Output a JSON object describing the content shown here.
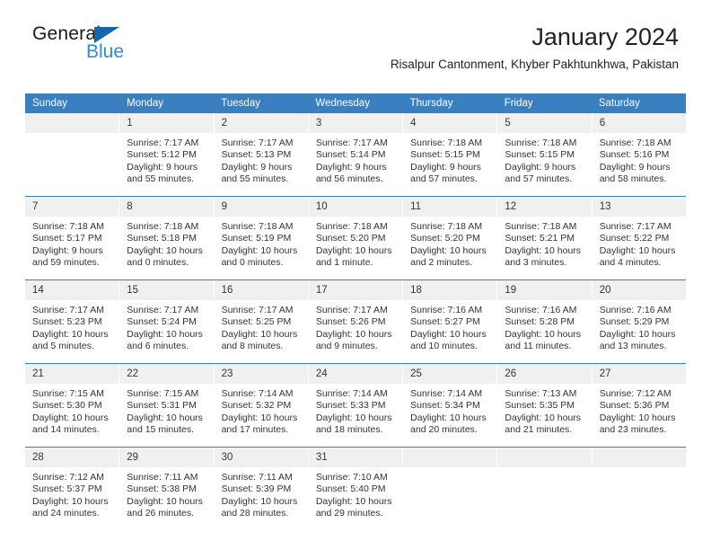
{
  "brand": {
    "name_part1": "General",
    "name_part2": "Blue"
  },
  "header": {
    "title": "January 2024",
    "subtitle": "Risalpur Cantonment, Khyber Pakhtunkhwa, Pakistan"
  },
  "colors": {
    "header_blue": "#3a7fc0",
    "logo_blue": "#1565b0",
    "logo_text_blue": "#2e8bd8",
    "day_number_bg": "#f0f0f0",
    "text": "#333333"
  },
  "weekdays": [
    "Sunday",
    "Monday",
    "Tuesday",
    "Wednesday",
    "Thursday",
    "Friday",
    "Saturday"
  ],
  "weeks": [
    [
      {
        "day": "",
        "sunrise": "",
        "sunset": "",
        "daylight": "",
        "empty": true
      },
      {
        "day": "1",
        "sunrise": "Sunrise: 7:17 AM",
        "sunset": "Sunset: 5:12 PM",
        "daylight": "Daylight: 9 hours and 55 minutes."
      },
      {
        "day": "2",
        "sunrise": "Sunrise: 7:17 AM",
        "sunset": "Sunset: 5:13 PM",
        "daylight": "Daylight: 9 hours and 55 minutes."
      },
      {
        "day": "3",
        "sunrise": "Sunrise: 7:17 AM",
        "sunset": "Sunset: 5:14 PM",
        "daylight": "Daylight: 9 hours and 56 minutes."
      },
      {
        "day": "4",
        "sunrise": "Sunrise: 7:18 AM",
        "sunset": "Sunset: 5:15 PM",
        "daylight": "Daylight: 9 hours and 57 minutes."
      },
      {
        "day": "5",
        "sunrise": "Sunrise: 7:18 AM",
        "sunset": "Sunset: 5:15 PM",
        "daylight": "Daylight: 9 hours and 57 minutes."
      },
      {
        "day": "6",
        "sunrise": "Sunrise: 7:18 AM",
        "sunset": "Sunset: 5:16 PM",
        "daylight": "Daylight: 9 hours and 58 minutes."
      }
    ],
    [
      {
        "day": "7",
        "sunrise": "Sunrise: 7:18 AM",
        "sunset": "Sunset: 5:17 PM",
        "daylight": "Daylight: 9 hours and 59 minutes."
      },
      {
        "day": "8",
        "sunrise": "Sunrise: 7:18 AM",
        "sunset": "Sunset: 5:18 PM",
        "daylight": "Daylight: 10 hours and 0 minutes."
      },
      {
        "day": "9",
        "sunrise": "Sunrise: 7:18 AM",
        "sunset": "Sunset: 5:19 PM",
        "daylight": "Daylight: 10 hours and 0 minutes."
      },
      {
        "day": "10",
        "sunrise": "Sunrise: 7:18 AM",
        "sunset": "Sunset: 5:20 PM",
        "daylight": "Daylight: 10 hours and 1 minute."
      },
      {
        "day": "11",
        "sunrise": "Sunrise: 7:18 AM",
        "sunset": "Sunset: 5:20 PM",
        "daylight": "Daylight: 10 hours and 2 minutes."
      },
      {
        "day": "12",
        "sunrise": "Sunrise: 7:18 AM",
        "sunset": "Sunset: 5:21 PM",
        "daylight": "Daylight: 10 hours and 3 minutes."
      },
      {
        "day": "13",
        "sunrise": "Sunrise: 7:17 AM",
        "sunset": "Sunset: 5:22 PM",
        "daylight": "Daylight: 10 hours and 4 minutes."
      }
    ],
    [
      {
        "day": "14",
        "sunrise": "Sunrise: 7:17 AM",
        "sunset": "Sunset: 5:23 PM",
        "daylight": "Daylight: 10 hours and 5 minutes."
      },
      {
        "day": "15",
        "sunrise": "Sunrise: 7:17 AM",
        "sunset": "Sunset: 5:24 PM",
        "daylight": "Daylight: 10 hours and 6 minutes."
      },
      {
        "day": "16",
        "sunrise": "Sunrise: 7:17 AM",
        "sunset": "Sunset: 5:25 PM",
        "daylight": "Daylight: 10 hours and 8 minutes."
      },
      {
        "day": "17",
        "sunrise": "Sunrise: 7:17 AM",
        "sunset": "Sunset: 5:26 PM",
        "daylight": "Daylight: 10 hours and 9 minutes."
      },
      {
        "day": "18",
        "sunrise": "Sunrise: 7:16 AM",
        "sunset": "Sunset: 5:27 PM",
        "daylight": "Daylight: 10 hours and 10 minutes."
      },
      {
        "day": "19",
        "sunrise": "Sunrise: 7:16 AM",
        "sunset": "Sunset: 5:28 PM",
        "daylight": "Daylight: 10 hours and 11 minutes."
      },
      {
        "day": "20",
        "sunrise": "Sunrise: 7:16 AM",
        "sunset": "Sunset: 5:29 PM",
        "daylight": "Daylight: 10 hours and 13 minutes."
      }
    ],
    [
      {
        "day": "21",
        "sunrise": "Sunrise: 7:15 AM",
        "sunset": "Sunset: 5:30 PM",
        "daylight": "Daylight: 10 hours and 14 minutes."
      },
      {
        "day": "22",
        "sunrise": "Sunrise: 7:15 AM",
        "sunset": "Sunset: 5:31 PM",
        "daylight": "Daylight: 10 hours and 15 minutes."
      },
      {
        "day": "23",
        "sunrise": "Sunrise: 7:14 AM",
        "sunset": "Sunset: 5:32 PM",
        "daylight": "Daylight: 10 hours and 17 minutes."
      },
      {
        "day": "24",
        "sunrise": "Sunrise: 7:14 AM",
        "sunset": "Sunset: 5:33 PM",
        "daylight": "Daylight: 10 hours and 18 minutes."
      },
      {
        "day": "25",
        "sunrise": "Sunrise: 7:14 AM",
        "sunset": "Sunset: 5:34 PM",
        "daylight": "Daylight: 10 hours and 20 minutes."
      },
      {
        "day": "26",
        "sunrise": "Sunrise: 7:13 AM",
        "sunset": "Sunset: 5:35 PM",
        "daylight": "Daylight: 10 hours and 21 minutes."
      },
      {
        "day": "27",
        "sunrise": "Sunrise: 7:12 AM",
        "sunset": "Sunset: 5:36 PM",
        "daylight": "Daylight: 10 hours and 23 minutes."
      }
    ],
    [
      {
        "day": "28",
        "sunrise": "Sunrise: 7:12 AM",
        "sunset": "Sunset: 5:37 PM",
        "daylight": "Daylight: 10 hours and 24 minutes."
      },
      {
        "day": "29",
        "sunrise": "Sunrise: 7:11 AM",
        "sunset": "Sunset: 5:38 PM",
        "daylight": "Daylight: 10 hours and 26 minutes."
      },
      {
        "day": "30",
        "sunrise": "Sunrise: 7:11 AM",
        "sunset": "Sunset: 5:39 PM",
        "daylight": "Daylight: 10 hours and 28 minutes."
      },
      {
        "day": "31",
        "sunrise": "Sunrise: 7:10 AM",
        "sunset": "Sunset: 5:40 PM",
        "daylight": "Daylight: 10 hours and 29 minutes."
      },
      {
        "day": "",
        "sunrise": "",
        "sunset": "",
        "daylight": "",
        "empty": true
      },
      {
        "day": "",
        "sunrise": "",
        "sunset": "",
        "daylight": "",
        "empty": true
      },
      {
        "day": "",
        "sunrise": "",
        "sunset": "",
        "daylight": "",
        "empty": true
      }
    ]
  ]
}
